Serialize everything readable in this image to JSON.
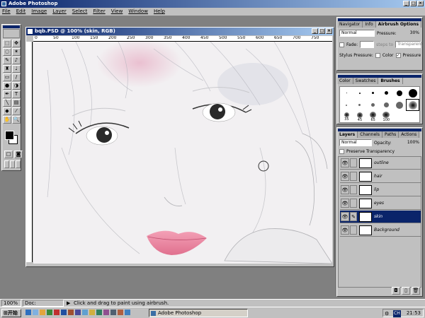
{
  "app": {
    "title": "Adobe Photoshop"
  },
  "menu": [
    "File",
    "Edit",
    "Image",
    "Layer",
    "Select",
    "Filter",
    "View",
    "Window",
    "Help"
  ],
  "document": {
    "title": "bqb.PSD @ 100% (skin, RGB)"
  },
  "ruler_h": [
    "0",
    "50",
    "100",
    "150",
    "200",
    "250",
    "300",
    "350",
    "400",
    "450",
    "500",
    "550",
    "600",
    "650",
    "700",
    "750"
  ],
  "airbrush_panel": {
    "tabs": [
      "Navigator",
      "Info",
      "Airbrush Options"
    ],
    "mode": "Normal",
    "pressure_label": "Pressure:",
    "pressure_value": "30%",
    "fade_label": "Fade:",
    "steps_label": "steps to",
    "steps_target": "Transparent",
    "stylus_label": "Stylus Pressure:",
    "color_label": "Color",
    "pressure_check_label": "Pressure"
  },
  "brushes_panel": {
    "tabs": [
      "Color",
      "Swatches",
      "Brushes"
    ],
    "sizes": [
      "35",
      "45",
      "65",
      "100"
    ]
  },
  "layers_panel": {
    "tabs": [
      "Layers",
      "Channels",
      "Paths",
      "Actions"
    ],
    "mode": "Normal",
    "opacity_label": "Opacity:",
    "opacity_value": "100%",
    "preserve_label": "Preserve Transparency",
    "layers": [
      {
        "name": "outline"
      },
      {
        "name": "hair"
      },
      {
        "name": "lip"
      },
      {
        "name": "eyes"
      },
      {
        "name": "skin"
      },
      {
        "name": "Background"
      }
    ]
  },
  "status": {
    "zoom": "100%",
    "doc": "Doc: 1.05M/6.40M",
    "hint": "Click and drag to paint using airbrush."
  },
  "taskbar": {
    "start": "开始",
    "task": "Adobe Photoshop",
    "ime": "CH",
    "time": "21:53"
  },
  "colors": {
    "title_bar": "#0a246a",
    "selection": "#0a246a",
    "chrome": "#c0c0c0",
    "desktop": "#808080",
    "lip": "#e8879f"
  }
}
